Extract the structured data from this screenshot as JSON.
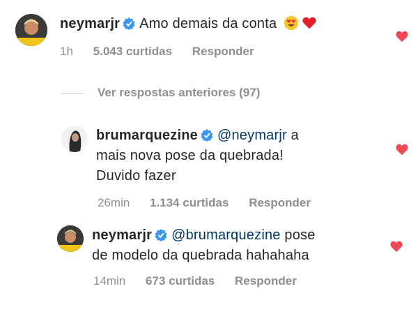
{
  "comments": [
    {
      "username": "neymarjr",
      "text": "Amo demais da conta",
      "emojis": [
        "heart-eyes-emoji",
        "red-heart-emoji"
      ],
      "time": "1h",
      "likes": "5.043 curtidas",
      "reply_label": "Responder",
      "liked": true
    },
    {
      "username": "brumarquezine",
      "mention": "@neymarjr",
      "text_line1_tail": " a",
      "text_line2": "mais nova pose da quebrada!",
      "text_line3": "Duvido fazer",
      "time": "26min",
      "likes": "1.134 curtidas",
      "reply_label": "Responder",
      "liked": true
    },
    {
      "username": "neymarjr",
      "mention": "@brumarquezine",
      "text_line1_tail": " pose",
      "text_line2": "de modelo da quebrada hahahaha",
      "time": "14min",
      "likes": "673 curtidas",
      "reply_label": "Responder",
      "liked": true
    }
  ],
  "view_previous": "Ver respostas anteriores (97)",
  "colors": {
    "text": "#262626",
    "secondary": "#8e8e8e",
    "verified": "#3897f0",
    "heart": "#ed4956",
    "mention": "#00376b"
  }
}
